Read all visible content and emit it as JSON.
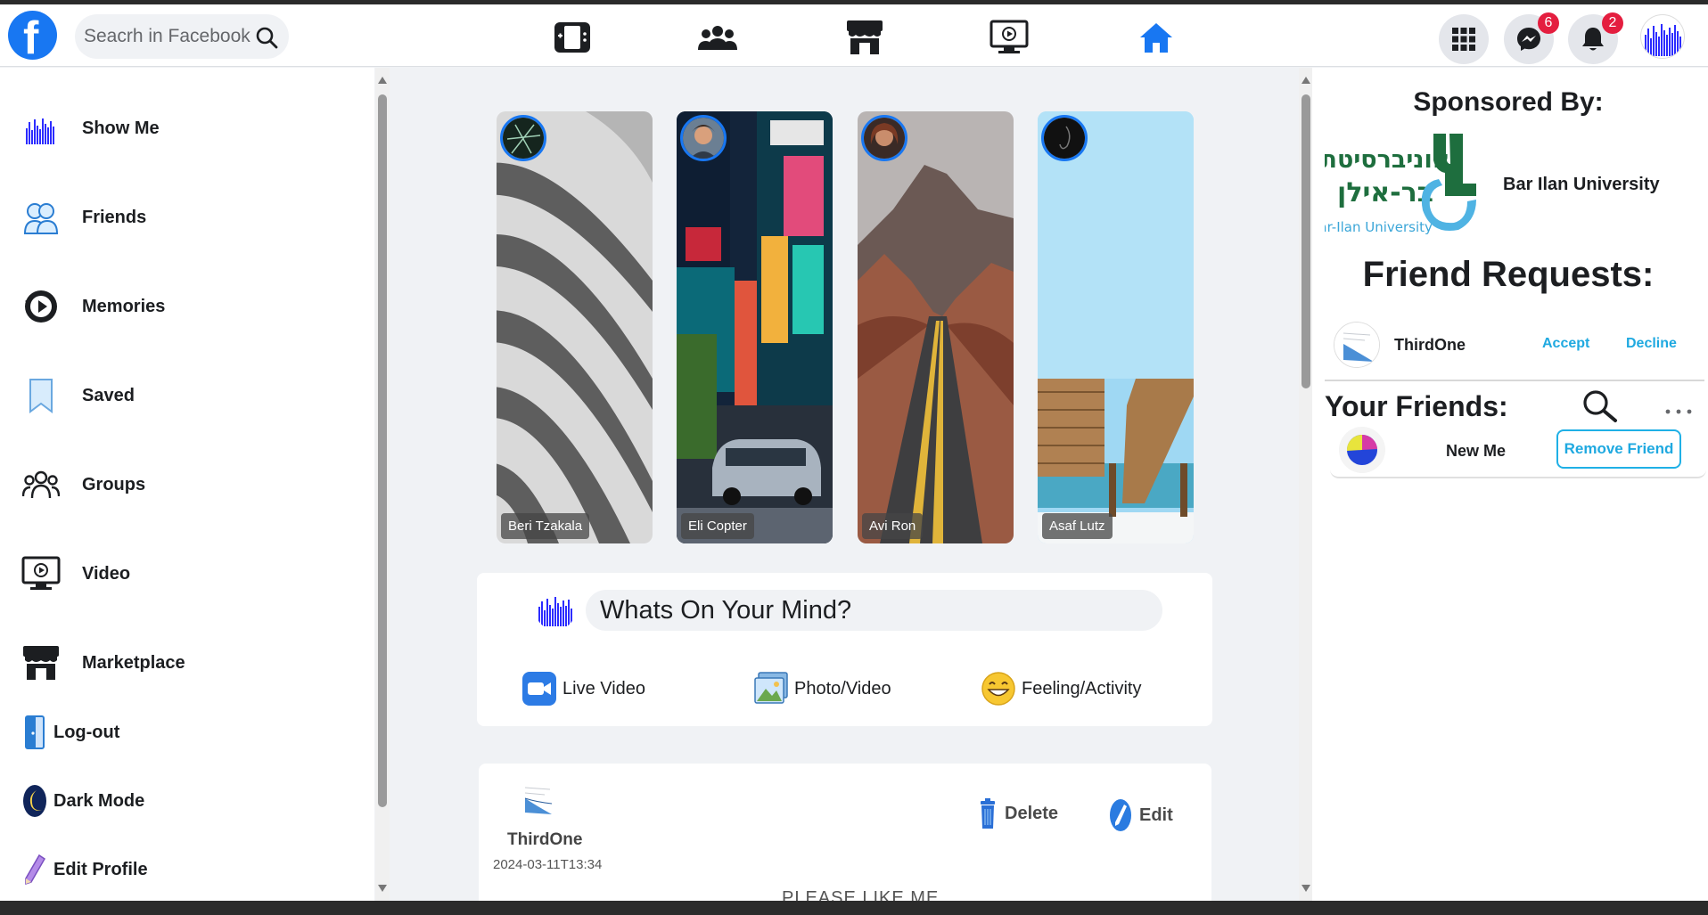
{
  "header": {
    "search_placeholder": "Seacrh in Facebook",
    "messenger_badge": "6",
    "notifications_badge": "2"
  },
  "sidebar": {
    "items": [
      {
        "label": "Show Me"
      },
      {
        "label": "Friends"
      },
      {
        "label": "Memories"
      },
      {
        "label": "Saved"
      },
      {
        "label": "Groups"
      },
      {
        "label": "Video"
      },
      {
        "label": "Marketplace"
      },
      {
        "label": "Log-out"
      },
      {
        "label": "Dark Mode"
      },
      {
        "label": "Edit Profile"
      }
    ]
  },
  "stories": [
    {
      "name": "Beri Tzakala"
    },
    {
      "name": "Eli Copter"
    },
    {
      "name": "Avi Ron"
    },
    {
      "name": "Asaf Lutz"
    }
  ],
  "composer": {
    "placeholder": "Whats On Your Mind?",
    "live_video": "Live Video",
    "photo_video": "Photo/Video",
    "feeling": "Feeling/Activity"
  },
  "post": {
    "author": "ThirdOne",
    "date": "2024-03-11T13:34",
    "delete_label": "Delete",
    "edit_label": "Edit",
    "body": "PLEASE LIKE ME"
  },
  "right": {
    "sponsored_title": "Sponsored By:",
    "sponsor_name": "Bar Ilan University",
    "sponsor_logo_hebrew_line1": "אוניברסיטת",
    "sponsor_logo_hebrew_line2": "בר-אילן",
    "sponsor_logo_english": "Bar-Ilan University",
    "friend_requests_title": "Friend Requests:",
    "request": {
      "name": "ThirdOne",
      "accept": "Accept",
      "decline": "Decline"
    },
    "your_friends_title": "Your Friends:",
    "friend": {
      "name": "New Me",
      "remove": "Remove Friend"
    }
  },
  "colors": {
    "brand": "#1877f2",
    "accent_link": "#1fa9e0",
    "badge": "#e41e3f"
  }
}
